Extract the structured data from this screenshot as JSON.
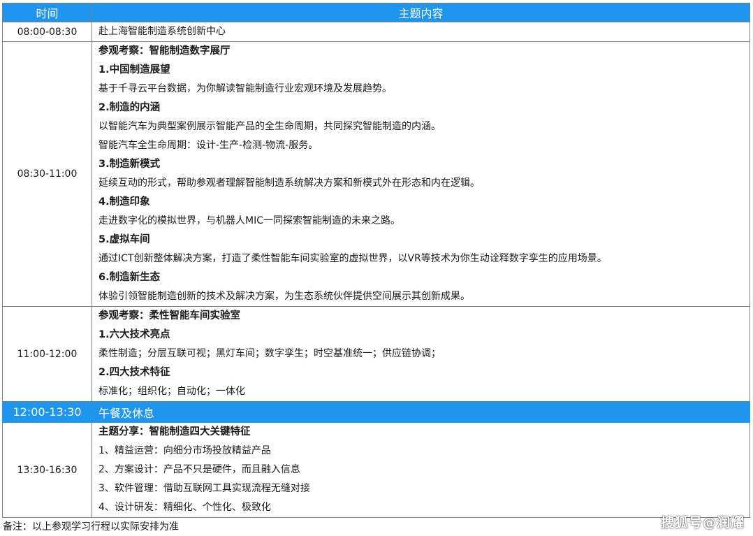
{
  "header": {
    "time_label": "时间",
    "content_label": "主题内容"
  },
  "rows": [
    {
      "time": "08:00-08:30",
      "lines": [
        {
          "text": "赴上海智能制造系统创新中心",
          "bold": false
        }
      ]
    },
    {
      "time": "08:30-11:00",
      "lines": [
        {
          "text": "参观考察：智能制造数字展厅",
          "bold": true
        },
        {
          "text": "1.中国制造展望",
          "bold": true
        },
        {
          "text": "基于千寻云平台数据，为你解读智能制造行业宏观环境及发展趋势。",
          "bold": false
        },
        {
          "text": "2.制造的内涵",
          "bold": true
        },
        {
          "text": "以智能汽车为典型案例展示智能产品的全生命周期，共同探究智能制造的内涵。",
          "bold": false
        },
        {
          "text": "智能汽车全生命周期：设计-生产-检测-物流-服务。",
          "bold": false
        },
        {
          "text": "3.制造新模式",
          "bold": true
        },
        {
          "text": "延续互动的形式，帮助参观者理解智能制造系统解决方案和新模式外在形态和内在逻辑。",
          "bold": false
        },
        {
          "text": "4.制造印象",
          "bold": true
        },
        {
          "text": "走进数字化的模拟世界，与机器人MIC一同探索智能制造的未来之路。",
          "bold": false
        },
        {
          "text": "5.虚拟车间",
          "bold": true
        },
        {
          "text": "通过ICT创新整体解决方案，打造了柔性智能车间实验室的虚拟世界，以VR等技术为你生动诠释数字孪生的应用场景。",
          "bold": false
        },
        {
          "text": "6.制造新生态",
          "bold": true
        },
        {
          "text": "体验引领智能制造创新的技术及解决方案，为生态系统伙伴提供空间展示其创新成果。",
          "bold": false
        }
      ]
    },
    {
      "time": "11:00-12:00",
      "lines": [
        {
          "text": "参观考察：柔性智能车间实验室",
          "bold": true
        },
        {
          "text": "1.六大技术亮点",
          "bold": true
        },
        {
          "text": "柔性制造；分层互联可视；黑灯车间；数字孪生；时空基准统一；供应链协调；",
          "bold": false
        },
        {
          "text": "2.四大技术特征",
          "bold": true
        },
        {
          "text": "标准化；组织化；自动化；一体化",
          "bold": false
        }
      ]
    }
  ],
  "lunch": {
    "time": "12:00-13:30",
    "text": "午餐及休息"
  },
  "afternoon": {
    "time": "13:30-16:30",
    "lines": [
      {
        "text": "主题分享：智能制造四大关键特征",
        "bold": true
      },
      {
        "text": "1、精益运营：向细分市场投放精益产品",
        "bold": false
      },
      {
        "text": "2、方案设计：产品不只是硬件，而且融入信息",
        "bold": false
      },
      {
        "text": "3、软件管理：借助互联网工具实现流程无缝对接",
        "bold": false
      },
      {
        "text": "4、设计研发：精细化、个性化、极致化",
        "bold": false
      }
    ]
  },
  "note": "备注：以上参观学习行程以实际安排为准",
  "watermark": "搜狐号@润耀",
  "colors": {
    "header_bg": "#1e96f0",
    "header_text": "#ffffff",
    "border": "#7f7f7f"
  }
}
